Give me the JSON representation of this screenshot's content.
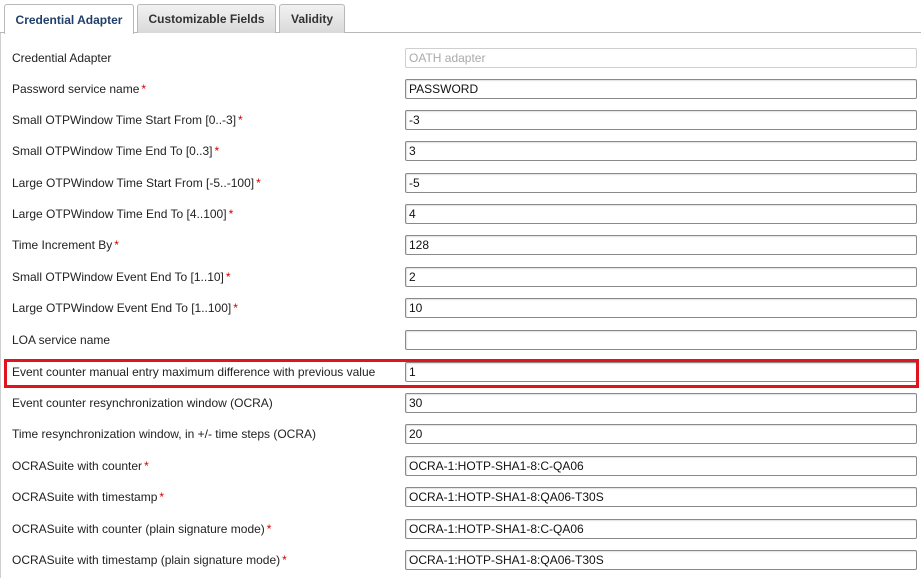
{
  "tabs": [
    {
      "label": "Credential Adapter",
      "active": true
    },
    {
      "label": "Customizable Fields",
      "active": false
    },
    {
      "label": "Validity",
      "active": false
    }
  ],
  "fields": [
    {
      "label": "Credential Adapter",
      "required": false,
      "value": "",
      "placeholder": "OATH adapter",
      "disabled": true
    },
    {
      "label": "Password service name",
      "required": true,
      "value": "PASSWORD"
    },
    {
      "label": "Small OTPWindow Time Start From [0..-3]",
      "required": true,
      "value": "-3"
    },
    {
      "label": "Small OTPWindow Time End To [0..3]",
      "required": true,
      "value": "3"
    },
    {
      "label": "Large OTPWindow Time Start From [-5..-100]",
      "required": true,
      "value": "-5"
    },
    {
      "label": "Large OTPWindow Time End To [4..100]",
      "required": true,
      "value": "4"
    },
    {
      "label": "Time Increment By",
      "required": true,
      "value": "128"
    },
    {
      "label": "Small OTPWindow Event End To [1..10]",
      "required": true,
      "value": "2"
    },
    {
      "label": "Large OTPWindow Event End To [1..100]",
      "required": true,
      "value": "10"
    },
    {
      "label": "LOA service name",
      "required": false,
      "value": ""
    },
    {
      "label": "Event counter manual entry maximum difference with previous value",
      "required": false,
      "value": "1",
      "highlighted": true
    },
    {
      "label": "Event counter resynchronization window (OCRA)",
      "required": false,
      "value": "30"
    },
    {
      "label": "Time resynchronization window, in +/- time steps (OCRA)",
      "required": false,
      "value": "20"
    },
    {
      "label": "OCRASuite with counter",
      "required": true,
      "value": "OCRA-1:HOTP-SHA1-8:C-QA06"
    },
    {
      "label": "OCRASuite with timestamp",
      "required": true,
      "value": "OCRA-1:HOTP-SHA1-8:QA06-T30S"
    },
    {
      "label": "OCRASuite with counter (plain signature mode)",
      "required": true,
      "value": "OCRA-1:HOTP-SHA1-8:C-QA06"
    },
    {
      "label": "OCRASuite with timestamp (plain signature mode)",
      "required": true,
      "value": "OCRA-1:HOTP-SHA1-8:QA06-T30S"
    }
  ],
  "required_marker": "*",
  "colors": {
    "required": "#d00000",
    "highlight": "#e0141e",
    "active_tab_text": "#1f3f6b"
  }
}
